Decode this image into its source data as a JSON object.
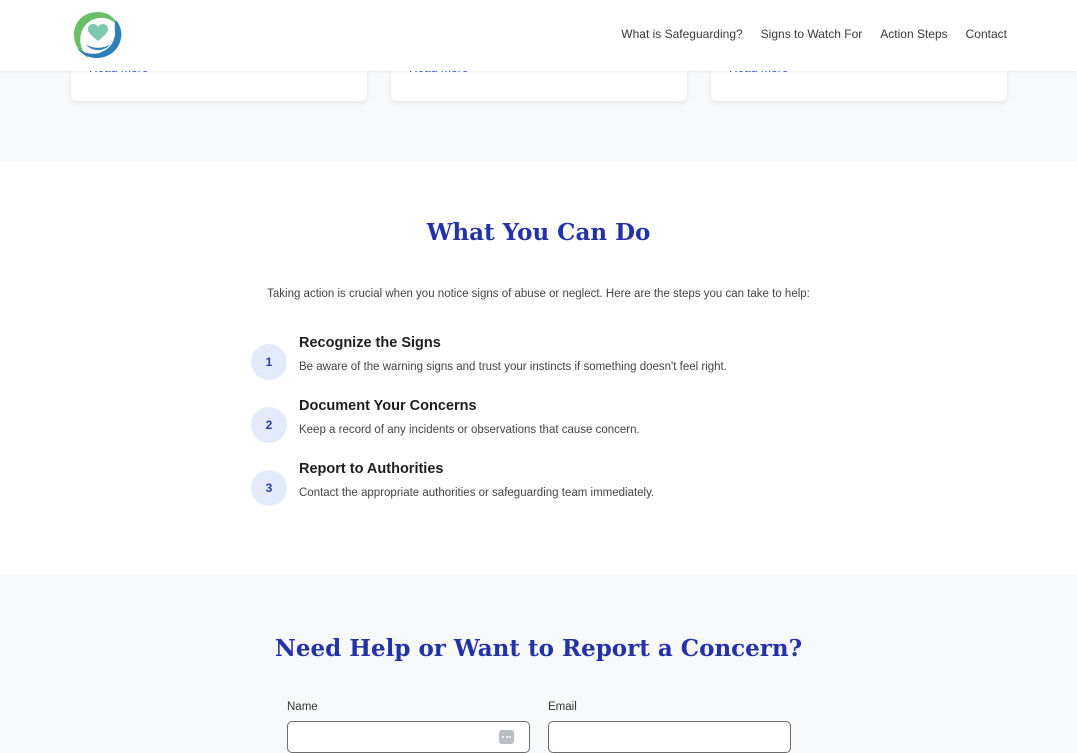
{
  "header": {
    "logo_name": "heart-hands-logo",
    "nav": [
      "What is Safeguarding?",
      "Signs to Watch For",
      "Action Steps",
      "Contact"
    ]
  },
  "cards": [
    {
      "read_more": "Read More"
    },
    {
      "read_more": "Read More"
    },
    {
      "read_more": "Read More"
    }
  ],
  "do_section": {
    "title": "What You Can Do",
    "intro": "Taking action is crucial when you notice signs of abuse or neglect. Here are the steps you can take to help:",
    "steps": [
      {
        "number": "1",
        "title": "Recognize the Signs",
        "text": "Be aware of the warning signs and trust your instincts if something doesn't feel right."
      },
      {
        "number": "2",
        "title": "Document Your Concerns",
        "text": "Keep a record of any incidents or observations that cause concern."
      },
      {
        "number": "3",
        "title": "Report to Authorities",
        "text": "Contact the appropriate authorities or safeguarding team immediately."
      }
    ]
  },
  "report_section": {
    "title": "Need Help or Want to Report a Concern?",
    "form": {
      "name_label": "Name",
      "name_value": "",
      "email_label": "Email",
      "email_value": ""
    }
  },
  "colors": {
    "accent": "#2333a6",
    "link": "#2f4fc6",
    "step_badge_bg": "#e3ebfb",
    "logo_blue": "#2e7fb8",
    "logo_green": "#6abf69"
  }
}
